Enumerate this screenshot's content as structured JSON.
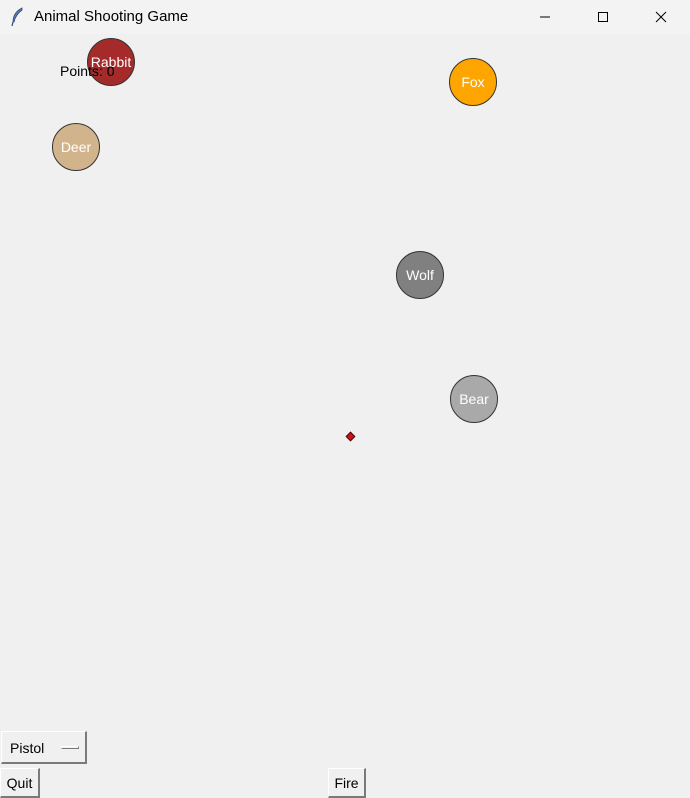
{
  "window": {
    "title": "Animal Shooting Game"
  },
  "game": {
    "points_label": "Points: 0",
    "animals": [
      {
        "name": "Rabbit",
        "color": "#a52a2a"
      },
      {
        "name": "Fox",
        "color": "#ffa500"
      },
      {
        "name": "Deer",
        "color": "#d2b48c"
      },
      {
        "name": "Wolf",
        "color": "#808080"
      },
      {
        "name": "Bear",
        "color": "#a9a9a9"
      }
    ],
    "crosshair_color": "#d0101a"
  },
  "controls": {
    "weapon_selected": "Pistol",
    "quit_label": "Quit",
    "fire_label": "Fire"
  }
}
